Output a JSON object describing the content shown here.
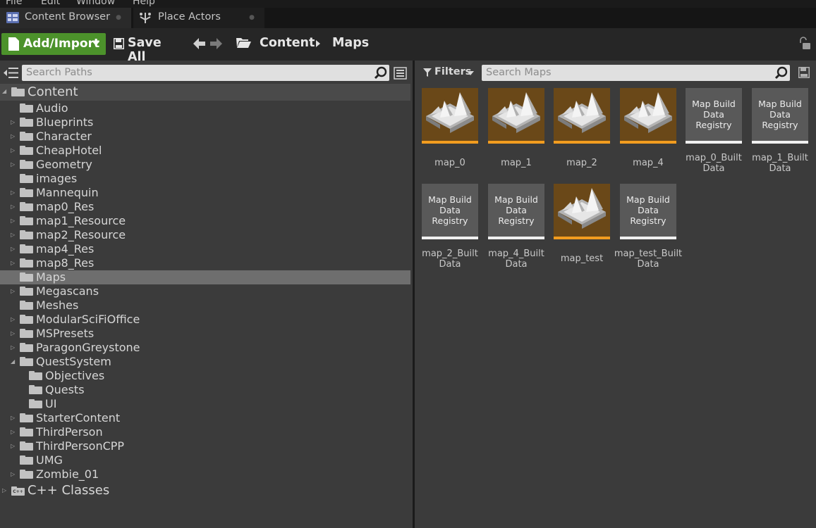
{
  "menu": [
    "File",
    "Edit",
    "Window",
    "Help"
  ],
  "tabs": [
    {
      "label": "Content Browser",
      "icon": "content-browser-icon"
    },
    {
      "label": "Place Actors",
      "icon": "place-actors-icon"
    }
  ],
  "toolbar": {
    "add_import": "Add/Import",
    "save_all": "Save All",
    "breadcrumb": [
      "Content",
      "Maps"
    ]
  },
  "sources": {
    "search_placeholder": "Search Paths",
    "root": "Content",
    "folders": [
      {
        "name": "Audio",
        "expandable": false
      },
      {
        "name": "Blueprints",
        "expandable": true
      },
      {
        "name": "Character",
        "expandable": true
      },
      {
        "name": "CheapHotel",
        "expandable": true
      },
      {
        "name": "Geometry",
        "expandable": true
      },
      {
        "name": "images",
        "expandable": false
      },
      {
        "name": "Mannequin",
        "expandable": true
      },
      {
        "name": "map0_Res",
        "expandable": true
      },
      {
        "name": "map1_Resource",
        "expandable": true
      },
      {
        "name": "map2_Resource",
        "expandable": true
      },
      {
        "name": "map4_Res",
        "expandable": true
      },
      {
        "name": "map8_Res",
        "expandable": true
      },
      {
        "name": "Maps",
        "expandable": false,
        "selected": true
      },
      {
        "name": "Megascans",
        "expandable": true
      },
      {
        "name": "Meshes",
        "expandable": false
      },
      {
        "name": "ModularSciFiOffice",
        "expandable": true
      },
      {
        "name": "MSPresets",
        "expandable": true
      },
      {
        "name": "ParagonGreystone",
        "expandable": true
      },
      {
        "name": "QuestSystem",
        "expandable": true,
        "expanded": true
      },
      {
        "name": "Objectives",
        "expandable": false,
        "child": true
      },
      {
        "name": "Quests",
        "expandable": false,
        "child": true
      },
      {
        "name": "UI",
        "expandable": false,
        "child": true
      },
      {
        "name": "StarterContent",
        "expandable": true
      },
      {
        "name": "ThirdPerson",
        "expandable": true
      },
      {
        "name": "ThirdPersonCPP",
        "expandable": true
      },
      {
        "name": "UMG",
        "expandable": false
      },
      {
        "name": "Zombie_01",
        "expandable": true
      }
    ],
    "cpp_root": "C++ Classes"
  },
  "assets": {
    "filters_label": "Filters",
    "search_placeholder": "Search Maps",
    "registry_label": "Map Build Data Registry",
    "registry_lines": [
      "Map Build",
      "Data",
      "Registry"
    ],
    "items": [
      {
        "name": "map_0",
        "kind": "map"
      },
      {
        "name": "map_1",
        "kind": "map"
      },
      {
        "name": "map_2",
        "kind": "map"
      },
      {
        "name": "map_4",
        "kind": "map"
      },
      {
        "name": "map_0_BuiltData",
        "name_lines": [
          "map_0_Built",
          "Data"
        ],
        "kind": "registry"
      },
      {
        "name": "map_1_BuiltData",
        "name_lines": [
          "map_1_Built",
          "Data"
        ],
        "kind": "registry"
      },
      {
        "name": "map_2_BuiltData",
        "name_lines": [
          "map_2_Built",
          "Data"
        ],
        "kind": "registry"
      },
      {
        "name": "map_4_BuiltData",
        "name_lines": [
          "map_4_Built",
          "Data"
        ],
        "kind": "registry"
      },
      {
        "name": "map_test",
        "kind": "map"
      },
      {
        "name": "map_test_BuiltData",
        "name_lines": [
          "map_test_Built",
          "Data"
        ],
        "kind": "registry"
      }
    ]
  },
  "colors": {
    "add_button": "#4c922b",
    "map_accent": "#f29c1f",
    "selected_row": "#6e6e6e"
  }
}
